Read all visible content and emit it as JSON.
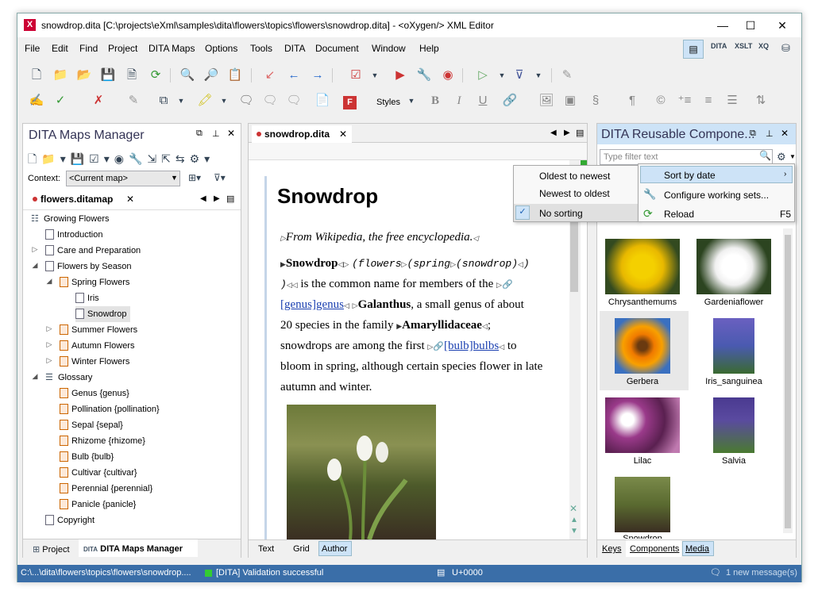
{
  "window": {
    "title": "snowdrop.dita [C:\\projects\\eXml\\samples\\dita\\flowers\\topics\\flowers\\snowdrop.dita] - <oXygen/> XML Editor",
    "minimize": "—",
    "maximize": "☐",
    "close": "✕"
  },
  "menu": [
    "File",
    "Edit",
    "Find",
    "Project",
    "DITA Maps",
    "Options",
    "Tools",
    "DITA",
    "Document",
    "Window",
    "Help"
  ],
  "toolbar2": {
    "styles": "Styles"
  },
  "maps_manager": {
    "title": "DITA Maps Manager",
    "context_label": "Context:",
    "context_value": "<Current map>",
    "tab": "flowers.ditamap"
  },
  "tree": [
    {
      "label": "Growing Flowers"
    },
    {
      "label": "Introduction"
    },
    {
      "label": "Care and Preparation"
    },
    {
      "label": "Flowers by Season"
    },
    {
      "label": "Spring Flowers"
    },
    {
      "label": "Iris"
    },
    {
      "label": "Snowdrop"
    },
    {
      "label": "Summer Flowers"
    },
    {
      "label": "Autumn Flowers"
    },
    {
      "label": "Winter Flowers"
    },
    {
      "label": "Glossary"
    },
    {
      "label": "Genus {genus}"
    },
    {
      "label": "Pollination {pollination}"
    },
    {
      "label": "Sepal {sepal}"
    },
    {
      "label": "Rhizome {rhizome}"
    },
    {
      "label": "Bulb {bulb}"
    },
    {
      "label": "Cultivar {cultivar}"
    },
    {
      "label": "Perennial {perennial}"
    },
    {
      "label": "Panicle {panicle}"
    },
    {
      "label": "Copyright"
    }
  ],
  "left_bottom_tabs": {
    "project": "Project",
    "maps": "DITA Maps Manager"
  },
  "editor": {
    "tab": "snowdrop.dita",
    "heading": "Snowdrop",
    "shortdesc": "From Wikipedia, the free encyclopedia.",
    "t_snowdrop": "Snowdrop",
    "t_flowers": "(flowers",
    "t_spring": "(spring",
    "t_snowdrop2": "(snowdrop)",
    "t_close": ")",
    "t_close2": ")",
    "t_common": "is the common name for members of the",
    "t_genus": "[genus]genus",
    "t_galanthus": "Galanthus",
    "t_small": ", a small genus of about",
    "t_line4": "20 species in the family",
    "t_amary": "Amaryllidaceae",
    "t_semi": ";",
    "t_line5a": "snowdrops are among the first",
    "t_bulbs": "[bulb]bulbs",
    "t_to": "to",
    "t_line6": "bloom in spring, although certain species flower in late",
    "t_line7": "autumn and winter."
  },
  "editor_tabs": {
    "text": "Text",
    "grid": "Grid",
    "author": "Author"
  },
  "sort_menu": {
    "oldest": "Oldest to newest",
    "newest": "Newest to oldest",
    "nosort": "No sorting",
    "check": "✓"
  },
  "ctx_menu": {
    "sort": "Sort by date",
    "configure": "Configure working sets...",
    "reload": "Reload",
    "reload_key": "F5"
  },
  "reusable": {
    "title": "DITA Reusable Compone...",
    "filter_placeholder": "Type filter text"
  },
  "images": [
    {
      "label": "Chrysanthemums"
    },
    {
      "label": "Gardeniaflower"
    },
    {
      "label": "Gerbera"
    },
    {
      "label": "Iris_sanguinea"
    },
    {
      "label": "Lilac"
    },
    {
      "label": "Salvia"
    },
    {
      "label": "Snowdrop"
    }
  ],
  "right_bottom_tabs": {
    "keys": "Keys",
    "components": "Components",
    "media": "Media"
  },
  "status": {
    "path": "C:\\...\\dita\\flowers\\topics\\flowers\\snowdrop....",
    "validation": "[DITA] Validation successful",
    "unicode": "U+0000",
    "messages": "1 new message(s)"
  }
}
